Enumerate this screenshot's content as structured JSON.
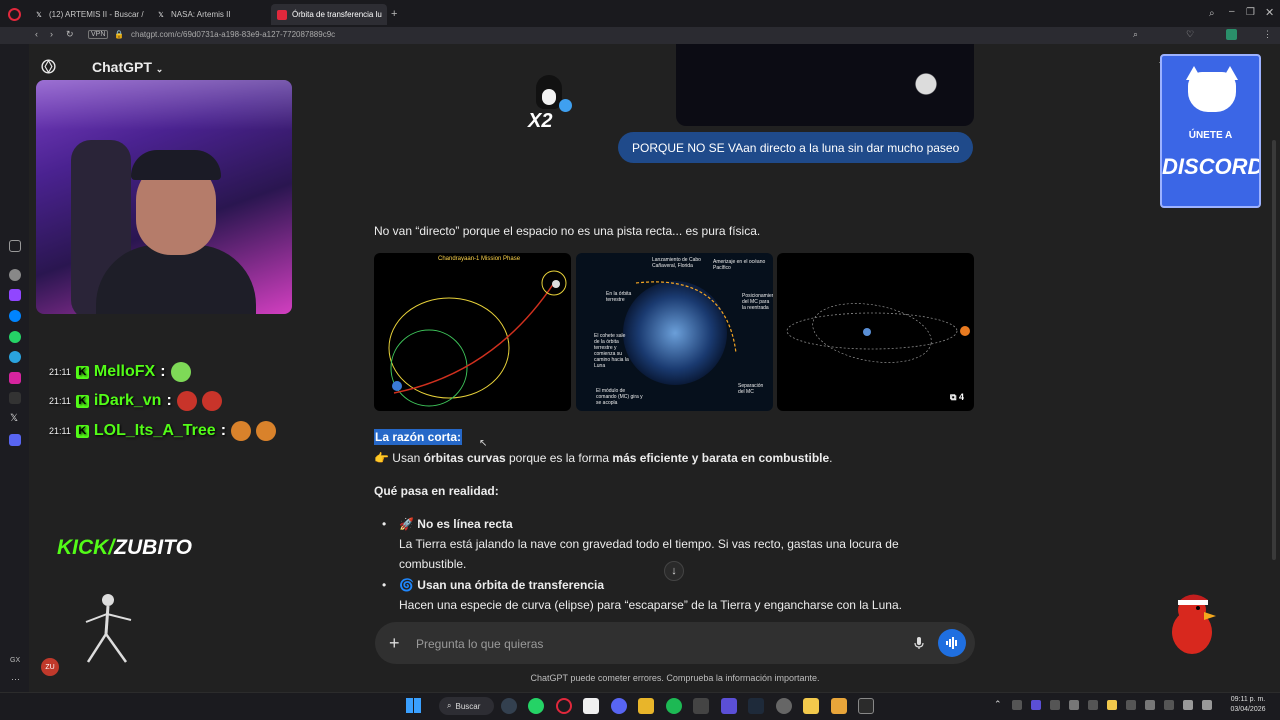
{
  "browser": {
    "tabs": [
      {
        "label": "(12) ARTEMIS II - Buscar /",
        "icon": "x-icon"
      },
      {
        "label": "NASA: Artemis II",
        "icon": "x-icon"
      },
      {
        "label": "Órbita de transferencia lu",
        "icon": "opera-icon",
        "active": true
      }
    ],
    "url": "chatgpt.com/c/69d0731a-a198-83e9-a127-772087889c9c",
    "vpn_label": "VPN"
  },
  "chatgpt": {
    "title": "ChatGPT",
    "user_message": "PORQUE NO SE VAan directo a la luna sin dar mucho paseo",
    "intro": "No van “directo” porque el espacio no es una pista recta... es pura física.",
    "thumbs": [
      {
        "caption": "Chandrayaan-1 Mission Phase"
      },
      {
        "labels": [
          "Lanzamiento de Cabo Cañaveral, Florida",
          "Amerizaje en el océano Pacífico",
          "En la órbita terrestre",
          "Posicionamiento del MC para la reentrada",
          "El cohete sale de la órbita terrestre y comienza su camino hacia la Luna",
          "El módulo de comando (MC) gira y se acopla",
          "Separación del MC"
        ]
      },
      {
        "more_count": "4"
      }
    ],
    "short_reason_heading": "La razón corta:",
    "short_reason_parts": [
      "👉 Usan ",
      "órbitas curvas",
      " porque es la forma ",
      "más eficiente y barata en combustible",
      "."
    ],
    "what_happens": "Qué pasa en realidad:",
    "bullets": [
      {
        "emoji": "🚀",
        "title": "No es línea recta",
        "text": "La Tierra está jalando la nave con gravedad todo el tiempo. Si vas recto, gastas una locura de combustible."
      },
      {
        "emoji": "🌀",
        "title": "Usan una órbita de transferencia",
        "text": "Hacen una especie de curva (elipse) para “escaparse” de la Tierra y engancharse con la Luna."
      }
    ],
    "input_placeholder": "Pregunta lo que quieras",
    "disclaimer": "ChatGPT puede cometer errores. Comprueba la información importante."
  },
  "stream": {
    "chat": [
      {
        "time": "21:11",
        "user": "MelloFX",
        "color": "#53fc18"
      },
      {
        "time": "21:11",
        "user": "iDark_vn",
        "color": "#53fc18"
      },
      {
        "time": "21:11",
        "user": "LOL_Its_A_Tree",
        "color": "#53fc18"
      }
    ],
    "kick_prefix": "KICK/",
    "kick_name": "ZUBITO",
    "discord_line1": "ÚNETE A",
    "discord_line2": "DISCORD",
    "avatar_initials": "ZU",
    "gx_label": "GX"
  },
  "taskbar": {
    "search_label": "Buscar",
    "time": "09:11 p. m.",
    "date": "03/04/2026"
  }
}
